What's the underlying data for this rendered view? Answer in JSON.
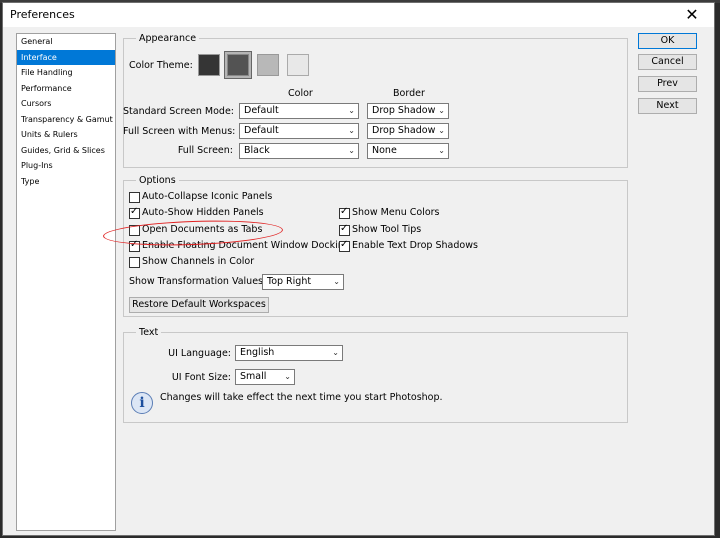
{
  "window": {
    "title": "Preferences",
    "close_glyph": "✕"
  },
  "sidebar": {
    "items": [
      {
        "label": "General"
      },
      {
        "label": "Interface"
      },
      {
        "label": "File Handling"
      },
      {
        "label": "Performance"
      },
      {
        "label": "Cursors"
      },
      {
        "label": "Transparency & Gamut"
      },
      {
        "label": "Units & Rulers"
      },
      {
        "label": "Guides, Grid & Slices"
      },
      {
        "label": "Plug-Ins"
      },
      {
        "label": "Type"
      }
    ],
    "selected_index": 1
  },
  "appearance": {
    "legend": "Appearance",
    "color_theme_label": "Color Theme:",
    "themes": [
      "#353535",
      "#535353",
      "#b8b8b8",
      "#e8e8e8"
    ],
    "selected_theme": 1,
    "col_color": "Color",
    "col_border": "Border",
    "rows": [
      {
        "label": "Standard Screen Mode:",
        "color": "Default",
        "border": "Drop Shadow"
      },
      {
        "label": "Full Screen with Menus:",
        "color": "Default",
        "border": "Drop Shadow"
      },
      {
        "label": "Full Screen:",
        "color": "Black",
        "border": "None"
      }
    ]
  },
  "options": {
    "legend": "Options",
    "left": [
      {
        "label": "Auto-Collapse Iconic Panels",
        "checked": false
      },
      {
        "label": "Auto-Show Hidden Panels",
        "checked": true
      },
      {
        "label": "Open Documents as Tabs",
        "checked": false
      },
      {
        "label": "Enable Floating Document Window Docking",
        "checked": true
      },
      {
        "label": "Show Channels in Color",
        "checked": false
      }
    ],
    "right": [
      {
        "label": "Show Menu Colors",
        "checked": true
      },
      {
        "label": "Show Tool Tips",
        "checked": true
      },
      {
        "label": "Enable Text Drop Shadows",
        "checked": true
      }
    ],
    "transform_label": "Show Transformation Values:",
    "transform_value": "Top Right",
    "restore_label": "Restore Default Workspaces"
  },
  "text": {
    "legend": "Text",
    "ui_language_label": "UI Language:",
    "ui_language_value": "English",
    "ui_font_size_label": "UI Font Size:",
    "ui_font_size_value": "Small",
    "info_message": "Changes will take effect the next time you start Photoshop.",
    "info_glyph": "i"
  },
  "buttons": {
    "ok": "OK",
    "cancel": "Cancel",
    "prev": "Prev",
    "next": "Next"
  },
  "check_glyph": "✓",
  "arrow_glyph": "⌄"
}
